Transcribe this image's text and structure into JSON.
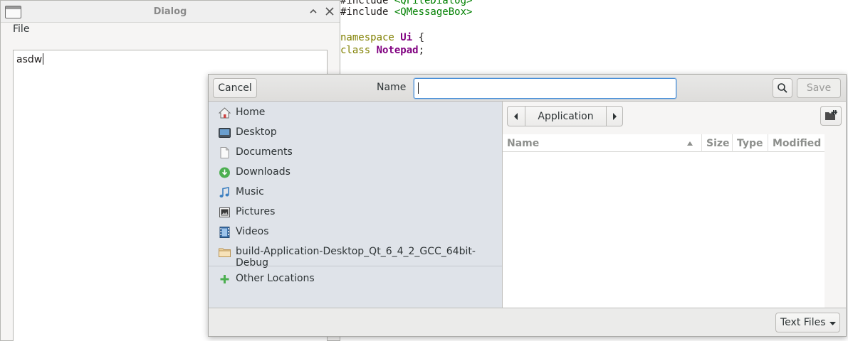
{
  "editor": {
    "lines": [
      {
        "parts": [
          {
            "t": "#include ",
            "c": ""
          },
          {
            "t": "<QFileDialog>",
            "c": "str"
          }
        ]
      },
      {
        "parts": [
          {
            "t": "#include ",
            "c": ""
          },
          {
            "t": "<QMessageBox>",
            "c": "str"
          }
        ]
      },
      {
        "parts": []
      },
      {
        "parts": [
          {
            "t": "namespace ",
            "c": "kw"
          },
          {
            "t": "Ui",
            "c": "kw2"
          },
          {
            "t": " {",
            "c": ""
          }
        ]
      },
      {
        "parts": [
          {
            "t": "class ",
            "c": "kw"
          },
          {
            "t": "Notepad",
            "c": "cls"
          },
          {
            "t": ";",
            "c": ""
          }
        ]
      }
    ]
  },
  "dialog": {
    "title": "Dialog",
    "menu": {
      "file": "File"
    },
    "text": "asdw"
  },
  "file_chooser": {
    "cancel_label": "Cancel",
    "name_label": "Name",
    "filename_value": "",
    "save_label": "Save",
    "places": [
      {
        "label": "Home",
        "icon": "home-icon"
      },
      {
        "label": "Desktop",
        "icon": "desktop-icon"
      },
      {
        "label": "Documents",
        "icon": "document-icon"
      },
      {
        "label": "Downloads",
        "icon": "download-icon"
      },
      {
        "label": "Music",
        "icon": "music-icon"
      },
      {
        "label": "Pictures",
        "icon": "pictures-icon"
      },
      {
        "label": "Videos",
        "icon": "video-icon"
      },
      {
        "label": "build-Application-Desktop_Qt_6_4_2_GCC_64bit-Debug",
        "icon": "folder-icon"
      }
    ],
    "other_locations": "Other Locations",
    "path": {
      "current": "Application"
    },
    "columns": {
      "name": "Name",
      "size": "Size",
      "type": "Type",
      "modified": "Modified"
    },
    "files": [],
    "filter": "Text Files"
  },
  "colors": {
    "accent": "#4a90d9",
    "sidebar_bg": "#dfe3e9",
    "download_green": "#4caf50",
    "add_green": "#4caf50",
    "music_blue": "#3c7fc0"
  }
}
